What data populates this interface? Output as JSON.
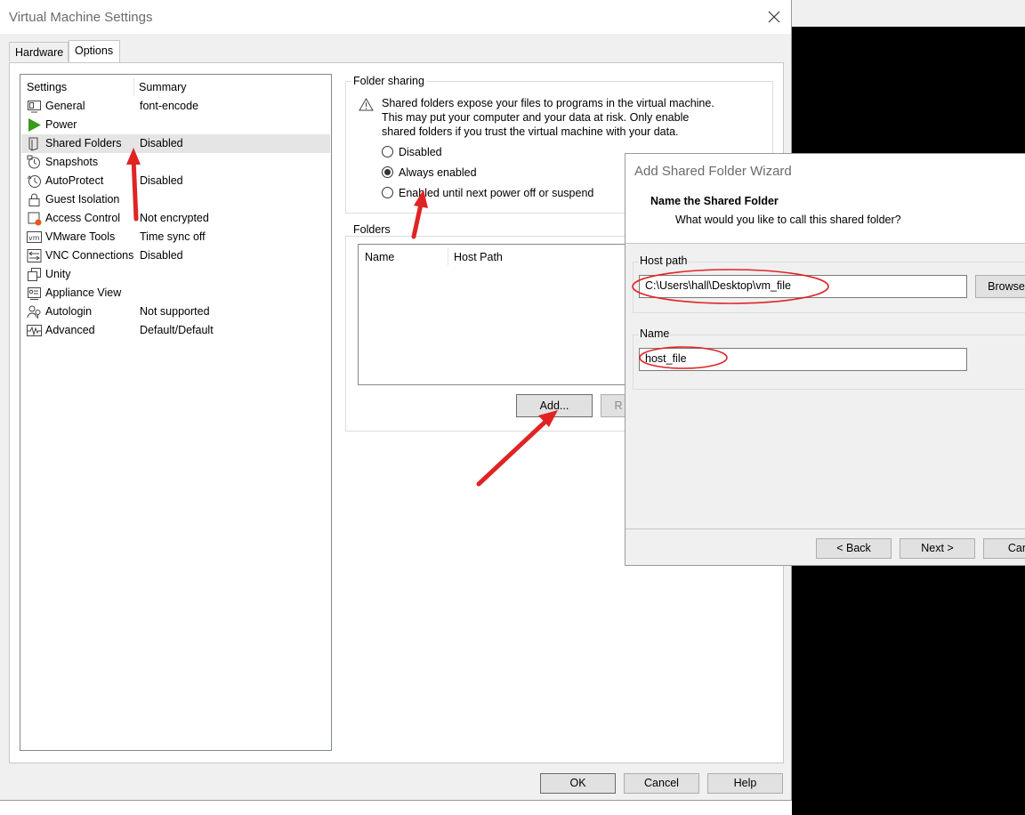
{
  "window": {
    "title": "Virtual Machine Settings"
  },
  "tabs": [
    {
      "label": "Hardware"
    },
    {
      "label": "Options"
    }
  ],
  "settings": {
    "header_setting": "Settings",
    "header_summary": "Summary",
    "items": [
      {
        "label": "General",
        "summary": "font-encode",
        "icon": "monitor-icon"
      },
      {
        "label": "Power",
        "summary": "",
        "icon": "power-play-icon"
      },
      {
        "label": "Shared Folders",
        "summary": "Disabled",
        "icon": "shared-folder-icon"
      },
      {
        "label": "Snapshots",
        "summary": "",
        "icon": "snapshot-icon"
      },
      {
        "label": "AutoProtect",
        "summary": "Disabled",
        "icon": "clock-icon"
      },
      {
        "label": "Guest Isolation",
        "summary": "",
        "icon": "lock-icon"
      },
      {
        "label": "Access Control",
        "summary": "Not encrypted",
        "icon": "access-control-icon"
      },
      {
        "label": "VMware Tools",
        "summary": "Time sync off",
        "icon": "vm-icon"
      },
      {
        "label": "VNC Connections",
        "summary": "Disabled",
        "icon": "vnc-icon"
      },
      {
        "label": "Unity",
        "summary": "",
        "icon": "unity-icon"
      },
      {
        "label": "Appliance View",
        "summary": "",
        "icon": "appliance-icon"
      },
      {
        "label": "Autologin",
        "summary": "Not supported",
        "icon": "users-icon"
      },
      {
        "label": "Advanced",
        "summary": "Default/Default",
        "icon": "waveform-icon"
      }
    ]
  },
  "folder_sharing": {
    "title": "Folder sharing",
    "warning_lines": [
      "Shared folders expose your files to programs in the virtual machine.",
      "This may put your computer and your data at risk. Only enable",
      "shared folders if you trust the virtual machine with your data."
    ],
    "options": [
      {
        "label": "Disabled",
        "selected": false
      },
      {
        "label": "Always enabled",
        "selected": true
      },
      {
        "label": "Enabled until next power off or suspend",
        "selected": false
      }
    ]
  },
  "folders": {
    "title": "Folders",
    "columns": [
      "Name",
      "Host Path"
    ],
    "add_label": "Add...",
    "remove_label": "R"
  },
  "footer": {
    "ok": "OK",
    "cancel": "Cancel",
    "help": "Help"
  },
  "wizard": {
    "title": "Add Shared Folder Wizard",
    "heading": "Name the Shared Folder",
    "subheading": "What would you like to call this shared folder?",
    "host_path_label": "Host path",
    "host_path_value": "C:\\Users\\hall\\Desktop\\vm_file",
    "browse_label": "Browse",
    "name_label": "Name",
    "name_value": "host_file",
    "back": "< Back",
    "next": "Next >",
    "cancel": "Canc"
  },
  "colors": {
    "annotation_red": "#e02424",
    "selection_bg": "#e5e5e5"
  }
}
